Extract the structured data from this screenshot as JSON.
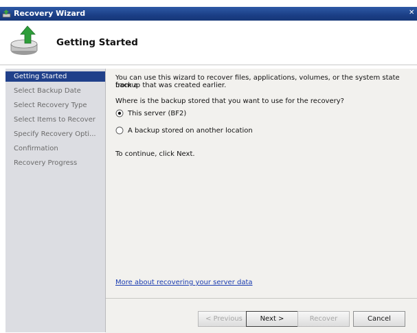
{
  "window": {
    "title": "Recovery Wizard"
  },
  "header": {
    "title": "Getting Started",
    "icon": "backup-restore-icon"
  },
  "nav": {
    "items": [
      {
        "label": "Getting Started",
        "active": true
      },
      {
        "label": "Select Backup Date",
        "active": false
      },
      {
        "label": "Select Recovery Type",
        "active": false
      },
      {
        "label": "Select Items to Recover",
        "active": false
      },
      {
        "label": "Specify Recovery Opti...",
        "active": false
      },
      {
        "label": "Confirmation",
        "active": false
      },
      {
        "label": "Recovery Progress",
        "active": false
      }
    ]
  },
  "content": {
    "intro_line1": "You can use this wizard to recover files, applications, volumes, or the system state from a",
    "intro_line2": "backup that was created earlier.",
    "question": "Where is the backup stored that you want to use for the recovery?",
    "options": [
      {
        "label": "This server (BF2)",
        "selected": true
      },
      {
        "label": "A backup stored on another location",
        "selected": false
      }
    ],
    "continue_text": "To continue, click Next.",
    "help_link": "More about recovering your server data"
  },
  "buttons": {
    "previous": "< Previous",
    "next": "Next >",
    "recover": "Recover",
    "cancel": "Cancel"
  },
  "colors": {
    "titlebar": "#1b3f86",
    "nav_bg": "#dcdde2",
    "nav_active": "#20408a",
    "content_bg": "#f2f1ee",
    "link": "#1a3cb0"
  }
}
